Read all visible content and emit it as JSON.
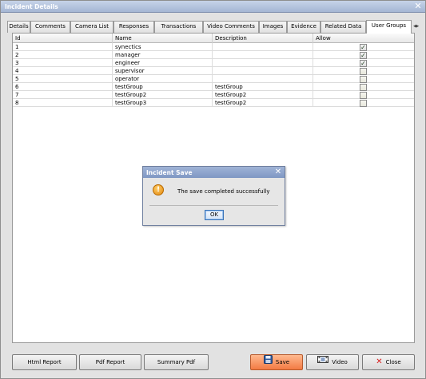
{
  "window": {
    "title": "Incident Details"
  },
  "tabs": [
    {
      "label": "Details"
    },
    {
      "label": "Comments"
    },
    {
      "label": "Camera List"
    },
    {
      "label": "Responses"
    },
    {
      "label": "Transactions"
    },
    {
      "label": "Video Comments"
    },
    {
      "label": "Images"
    },
    {
      "label": "Evidence"
    },
    {
      "label": "Related Data"
    },
    {
      "label": "User Groups",
      "active": true
    }
  ],
  "grid": {
    "columns": [
      "Id",
      "Name",
      "Description",
      "Allow"
    ],
    "rows": [
      {
        "id": "1",
        "name": "synectics",
        "description": "",
        "allow": true
      },
      {
        "id": "2",
        "name": "manager",
        "description": "",
        "allow": true
      },
      {
        "id": "3",
        "name": "engineer",
        "description": "",
        "allow": true
      },
      {
        "id": "4",
        "name": "supervisor",
        "description": "",
        "allow": false
      },
      {
        "id": "5",
        "name": "operator",
        "description": "",
        "allow": false
      },
      {
        "id": "6",
        "name": "testGroup",
        "description": "testGroup",
        "allow": false
      },
      {
        "id": "7",
        "name": "testGroup2",
        "description": "testGroup2",
        "allow": false
      },
      {
        "id": "8",
        "name": "testGroup3",
        "description": "testGroup2",
        "allow": false
      }
    ]
  },
  "dialog": {
    "title": "Incident Save",
    "message": "The save completed successfully",
    "ok_label": "OK",
    "icon": "warning-icon"
  },
  "buttons": {
    "html_report": "Html Report",
    "pdf_report": "Pdf Report",
    "summary_pdf": "Summary Pdf",
    "save": "Save",
    "video": "Video",
    "close": "Close"
  },
  "colors": {
    "save_accent": "#f37a43",
    "title_bar": "#a4b6d4",
    "close_x": "#d81e1e"
  }
}
